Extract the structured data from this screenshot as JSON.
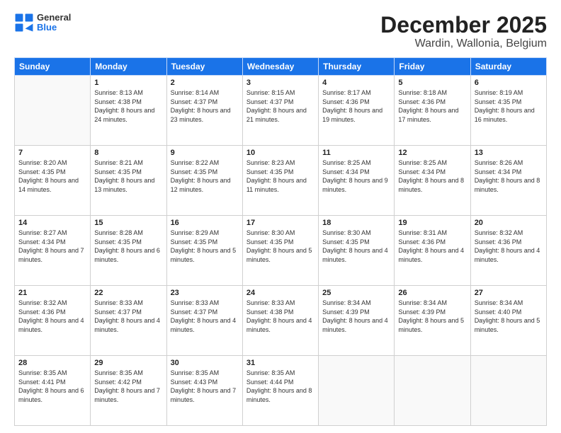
{
  "logo": {
    "general": "General",
    "blue": "Blue"
  },
  "title": "December 2025",
  "subtitle": "Wardin, Wallonia, Belgium",
  "days": [
    "Sunday",
    "Monday",
    "Tuesday",
    "Wednesday",
    "Thursday",
    "Friday",
    "Saturday"
  ],
  "weeks": [
    [
      {
        "day": "",
        "sunrise": "",
        "sunset": "",
        "daylight": ""
      },
      {
        "day": "1",
        "sunrise": "Sunrise: 8:13 AM",
        "sunset": "Sunset: 4:38 PM",
        "daylight": "Daylight: 8 hours and 24 minutes."
      },
      {
        "day": "2",
        "sunrise": "Sunrise: 8:14 AM",
        "sunset": "Sunset: 4:37 PM",
        "daylight": "Daylight: 8 hours and 23 minutes."
      },
      {
        "day": "3",
        "sunrise": "Sunrise: 8:15 AM",
        "sunset": "Sunset: 4:37 PM",
        "daylight": "Daylight: 8 hours and 21 minutes."
      },
      {
        "day": "4",
        "sunrise": "Sunrise: 8:17 AM",
        "sunset": "Sunset: 4:36 PM",
        "daylight": "Daylight: 8 hours and 19 minutes."
      },
      {
        "day": "5",
        "sunrise": "Sunrise: 8:18 AM",
        "sunset": "Sunset: 4:36 PM",
        "daylight": "Daylight: 8 hours and 17 minutes."
      },
      {
        "day": "6",
        "sunrise": "Sunrise: 8:19 AM",
        "sunset": "Sunset: 4:35 PM",
        "daylight": "Daylight: 8 hours and 16 minutes."
      }
    ],
    [
      {
        "day": "7",
        "sunrise": "Sunrise: 8:20 AM",
        "sunset": "Sunset: 4:35 PM",
        "daylight": "Daylight: 8 hours and 14 minutes."
      },
      {
        "day": "8",
        "sunrise": "Sunrise: 8:21 AM",
        "sunset": "Sunset: 4:35 PM",
        "daylight": "Daylight: 8 hours and 13 minutes."
      },
      {
        "day": "9",
        "sunrise": "Sunrise: 8:22 AM",
        "sunset": "Sunset: 4:35 PM",
        "daylight": "Daylight: 8 hours and 12 minutes."
      },
      {
        "day": "10",
        "sunrise": "Sunrise: 8:23 AM",
        "sunset": "Sunset: 4:35 PM",
        "daylight": "Daylight: 8 hours and 11 minutes."
      },
      {
        "day": "11",
        "sunrise": "Sunrise: 8:25 AM",
        "sunset": "Sunset: 4:34 PM",
        "daylight": "Daylight: 8 hours and 9 minutes."
      },
      {
        "day": "12",
        "sunrise": "Sunrise: 8:25 AM",
        "sunset": "Sunset: 4:34 PM",
        "daylight": "Daylight: 8 hours and 8 minutes."
      },
      {
        "day": "13",
        "sunrise": "Sunrise: 8:26 AM",
        "sunset": "Sunset: 4:34 PM",
        "daylight": "Daylight: 8 hours and 8 minutes."
      }
    ],
    [
      {
        "day": "14",
        "sunrise": "Sunrise: 8:27 AM",
        "sunset": "Sunset: 4:34 PM",
        "daylight": "Daylight: 8 hours and 7 minutes."
      },
      {
        "day": "15",
        "sunrise": "Sunrise: 8:28 AM",
        "sunset": "Sunset: 4:35 PM",
        "daylight": "Daylight: 8 hours and 6 minutes."
      },
      {
        "day": "16",
        "sunrise": "Sunrise: 8:29 AM",
        "sunset": "Sunset: 4:35 PM",
        "daylight": "Daylight: 8 hours and 5 minutes."
      },
      {
        "day": "17",
        "sunrise": "Sunrise: 8:30 AM",
        "sunset": "Sunset: 4:35 PM",
        "daylight": "Daylight: 8 hours and 5 minutes."
      },
      {
        "day": "18",
        "sunrise": "Sunrise: 8:30 AM",
        "sunset": "Sunset: 4:35 PM",
        "daylight": "Daylight: 8 hours and 4 minutes."
      },
      {
        "day": "19",
        "sunrise": "Sunrise: 8:31 AM",
        "sunset": "Sunset: 4:36 PM",
        "daylight": "Daylight: 8 hours and 4 minutes."
      },
      {
        "day": "20",
        "sunrise": "Sunrise: 8:32 AM",
        "sunset": "Sunset: 4:36 PM",
        "daylight": "Daylight: 8 hours and 4 minutes."
      }
    ],
    [
      {
        "day": "21",
        "sunrise": "Sunrise: 8:32 AM",
        "sunset": "Sunset: 4:36 PM",
        "daylight": "Daylight: 8 hours and 4 minutes."
      },
      {
        "day": "22",
        "sunrise": "Sunrise: 8:33 AM",
        "sunset": "Sunset: 4:37 PM",
        "daylight": "Daylight: 8 hours and 4 minutes."
      },
      {
        "day": "23",
        "sunrise": "Sunrise: 8:33 AM",
        "sunset": "Sunset: 4:37 PM",
        "daylight": "Daylight: 8 hours and 4 minutes."
      },
      {
        "day": "24",
        "sunrise": "Sunrise: 8:33 AM",
        "sunset": "Sunset: 4:38 PM",
        "daylight": "Daylight: 8 hours and 4 minutes."
      },
      {
        "day": "25",
        "sunrise": "Sunrise: 8:34 AM",
        "sunset": "Sunset: 4:39 PM",
        "daylight": "Daylight: 8 hours and 4 minutes."
      },
      {
        "day": "26",
        "sunrise": "Sunrise: 8:34 AM",
        "sunset": "Sunset: 4:39 PM",
        "daylight": "Daylight: 8 hours and 5 minutes."
      },
      {
        "day": "27",
        "sunrise": "Sunrise: 8:34 AM",
        "sunset": "Sunset: 4:40 PM",
        "daylight": "Daylight: 8 hours and 5 minutes."
      }
    ],
    [
      {
        "day": "28",
        "sunrise": "Sunrise: 8:35 AM",
        "sunset": "Sunset: 4:41 PM",
        "daylight": "Daylight: 8 hours and 6 minutes."
      },
      {
        "day": "29",
        "sunrise": "Sunrise: 8:35 AM",
        "sunset": "Sunset: 4:42 PM",
        "daylight": "Daylight: 8 hours and 7 minutes."
      },
      {
        "day": "30",
        "sunrise": "Sunrise: 8:35 AM",
        "sunset": "Sunset: 4:43 PM",
        "daylight": "Daylight: 8 hours and 7 minutes."
      },
      {
        "day": "31",
        "sunrise": "Sunrise: 8:35 AM",
        "sunset": "Sunset: 4:44 PM",
        "daylight": "Daylight: 8 hours and 8 minutes."
      },
      {
        "day": "",
        "sunrise": "",
        "sunset": "",
        "daylight": ""
      },
      {
        "day": "",
        "sunrise": "",
        "sunset": "",
        "daylight": ""
      },
      {
        "day": "",
        "sunrise": "",
        "sunset": "",
        "daylight": ""
      }
    ]
  ]
}
